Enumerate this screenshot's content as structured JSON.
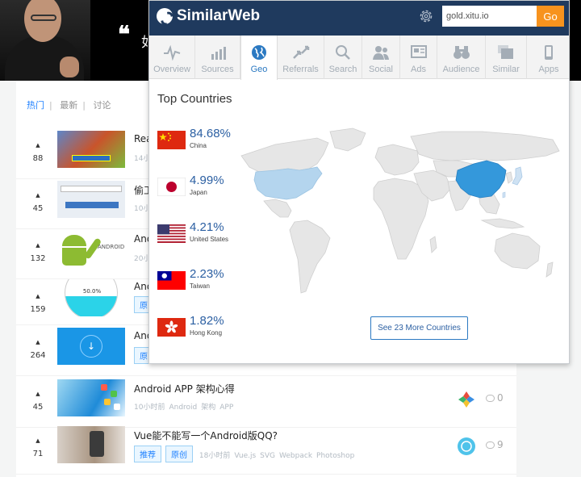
{
  "banner": {
    "quote_mark": "❝",
    "quote_text": "如"
  },
  "feed": {
    "tabs": [
      {
        "label": "热门"
      },
      {
        "label": "最新"
      },
      {
        "label": "讨论"
      }
    ],
    "rows": [
      {
        "votes": "88",
        "title": "Rea",
        "meta": [
          "14小"
        ]
      },
      {
        "votes": "45",
        "title": "偷工",
        "meta": [
          "10小"
        ]
      },
      {
        "votes": "132",
        "title": "And",
        "meta": [
          "20小"
        ]
      },
      {
        "votes": "159",
        "title": "And",
        "tags": [
          "原"
        ]
      },
      {
        "votes": "264",
        "title": "And",
        "tags": [
          "原"
        ]
      },
      {
        "votes": "45",
        "title": "Android APP 架构心得",
        "meta": [
          "10小时前",
          "Android",
          "架构",
          "APP"
        ],
        "comments": "0"
      },
      {
        "votes": "71",
        "title": "Vue能不能写一个Android版QQ?",
        "tags": [
          "推荐",
          "原创"
        ],
        "meta": [
          "18小时前",
          "Vue.js",
          "SVG",
          "Webpack",
          "Photoshop"
        ],
        "comments": "9"
      }
    ],
    "thumb_texts": {
      "circle_pct": "50.0%"
    }
  },
  "similarweb": {
    "brand": "SimilarWeb",
    "domain": "gold.xitu.io",
    "go_label": "Go",
    "nav": [
      {
        "label": "Overview",
        "icon": "overview-icon"
      },
      {
        "label": "Sources",
        "icon": "sources-icon"
      },
      {
        "label": "Geo",
        "icon": "globe-icon"
      },
      {
        "label": "Referrals",
        "icon": "referrals-icon"
      },
      {
        "label": "Search",
        "icon": "search-icon"
      },
      {
        "label": "Social",
        "icon": "social-icon"
      },
      {
        "label": "Ads",
        "icon": "ads-icon"
      },
      {
        "label": "Audience",
        "icon": "binoculars-icon"
      },
      {
        "label": "Similar",
        "icon": "similar-icon"
      },
      {
        "label": "Apps",
        "icon": "phone-icon"
      }
    ],
    "active_tab": "Geo",
    "heading": "Top Countries",
    "countries": [
      {
        "share": "84.68%",
        "name": "China"
      },
      {
        "share": "4.99%",
        "name": "Japan"
      },
      {
        "share": "4.21%",
        "name": "United States"
      },
      {
        "share": "2.23%",
        "name": "Taiwan"
      },
      {
        "share": "1.82%",
        "name": "Hong Kong"
      }
    ],
    "see_more_label": "See 23 More Countries",
    "colors": {
      "header": "#1f3a5e",
      "go": "#f7931e",
      "china": "#3498db",
      "us": "#b4d5ee",
      "land": "#e6e6e6"
    }
  }
}
